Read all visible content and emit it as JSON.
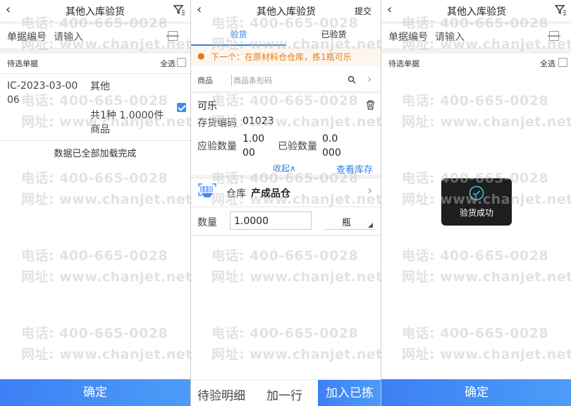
{
  "screen1": {
    "title": "其他入库验货",
    "doc_no_label": "单据编号",
    "doc_no_placeholder": "请输入",
    "list_title": "待选单据",
    "select_all_label": "全选",
    "item": {
      "doc_id_line1": "IC-2023-03-00",
      "doc_id_line2": "06",
      "type": "其他",
      "summary_line1": "共1种 1.0000件",
      "summary_line2": "商品",
      "checked": true
    },
    "loaded_text": "数据已全部加载完成",
    "confirm_label": "确定"
  },
  "screen2": {
    "title": "其他入库验货",
    "submit_label": "提交",
    "tabs": [
      {
        "label": "验货",
        "active": true
      },
      {
        "label": "已验货",
        "active": false
      }
    ],
    "hint": "下一个：在原材料仓仓库，拣1瓶可乐",
    "product_label": "商品",
    "barcode_placeholder": "商品条形码",
    "product_name": "可乐",
    "code_label": "存货编码",
    "code_value": "01023",
    "expected_label": "应验数量",
    "expected_value_line1": "1.00",
    "expected_value_line2": "00",
    "checked_label": "已验数量",
    "checked_value_line1": "0.0",
    "checked_value_line2": "000",
    "collapse_label": "收起∧",
    "view_stock_label": "查看库存",
    "warehouse_label": "仓库",
    "warehouse_value": "产成品仓",
    "qty_label": "数量",
    "qty_value": "1.0000",
    "unit": "瓶",
    "bottom_pending": "待验明细",
    "bottom_add_row": "加一行",
    "bottom_add_picked": "加入已拣"
  },
  "screen3": {
    "title": "其他入库验货",
    "doc_no_label": "单据编号",
    "doc_no_placeholder": "请输入",
    "list_title": "待选单据",
    "select_all_label": "全选",
    "toast_text": "验货成功",
    "confirm_label": "确定"
  },
  "watermark": {
    "phone": "电话: 400-665-0028",
    "site": "网址: www.chanjet.net"
  },
  "colors": {
    "accent": "#3d7ff5",
    "hint_orange": "#e07b1a",
    "link_blue": "#2e7fe6"
  }
}
